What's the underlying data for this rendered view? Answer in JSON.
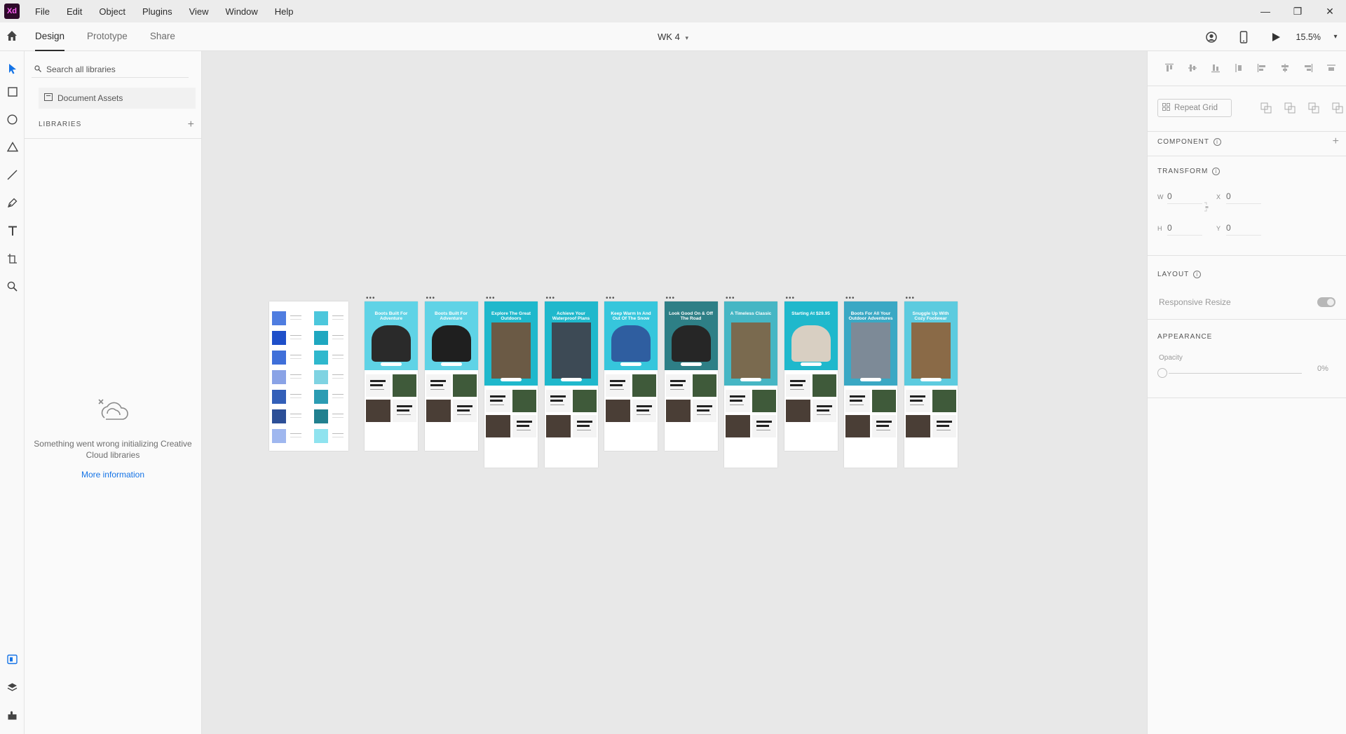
{
  "app": {
    "logo_text": "Xd"
  },
  "menu": [
    "File",
    "Edit",
    "Object",
    "Plugins",
    "View",
    "Window",
    "Help"
  ],
  "window_controls": {
    "minimize": "—",
    "restore": "❐",
    "close": "✕"
  },
  "tabs": [
    "Design",
    "Prototype",
    "Share"
  ],
  "active_tab": "Design",
  "document": {
    "title": "WK 4",
    "zoom": "15.5%"
  },
  "libraries": {
    "search_placeholder": "Search all libraries",
    "document_assets": "Document Assets",
    "header": "LIBRARIES",
    "error_message": "Something went wrong initializing Creative Cloud libraries",
    "more_info": "More information"
  },
  "properties": {
    "repeat_grid": "Repeat Grid",
    "component": "COMPONENT",
    "transform": "TRANSFORM",
    "w_label": "W",
    "w_value": "0",
    "x_label": "X",
    "x_value": "0",
    "h_label": "H",
    "h_value": "0",
    "y_label": "Y",
    "y_value": "0",
    "layout": "LAYOUT",
    "responsive_resize": "Responsive Resize",
    "appearance": "APPEARANCE",
    "opacity_label": "Opacity",
    "opacity_value": "0%"
  },
  "artboards": [
    {
      "title": "Boots Built For Adventure",
      "hero_color": "#5fd3e6",
      "img_color": "#2a2a2a",
      "tall": false
    },
    {
      "title": "Boots Built For Adventure",
      "hero_color": "#5fd3e6",
      "img_color": "#1f1f1f",
      "tall": false
    },
    {
      "title": "Explore The Great Outdoors",
      "hero_color": "#1fb8cc",
      "img_color": "#6b5a45",
      "tall": true
    },
    {
      "title": "Achieve Your Waterproof Plans",
      "hero_color": "#1fb8cc",
      "img_color": "#3d4a55",
      "tall": true
    },
    {
      "title": "Keep Warm In And Out Of The Snow",
      "hero_color": "#36c6dc",
      "img_color": "#2f5ea0",
      "tall": false
    },
    {
      "title": "Look Good On & Off The Road",
      "hero_color": "#2e7f86",
      "img_color": "#262626",
      "tall": false
    },
    {
      "title": "A Timeless Classic",
      "hero_color": "#46b6c4",
      "img_color": "#7a6a4f",
      "tall": true
    },
    {
      "title": "Starting At $29.95",
      "hero_color": "#1fb8cc",
      "img_color": "#d8cfc2",
      "tall": false
    },
    {
      "title": "Boots For All Your Outdoor Adventures",
      "hero_color": "#3aa8c4",
      "img_color": "#7d8a97",
      "tall": true
    },
    {
      "title": "Snuggle Up With Cozy Footwear",
      "hero_color": "#5ccbdf",
      "img_color": "#8a6a47",
      "tall": true
    }
  ],
  "palette": {
    "left": [
      "#4f7de0",
      "#1e4fc9",
      "#3f6fd9",
      "#8aa3e6",
      "#335fb8",
      "#2c4f97",
      "#9fb7ef"
    ],
    "right": [
      "#4cc7dc",
      "#1fa7c0",
      "#2fb8cd",
      "#7fd3e2",
      "#2b9cb3",
      "#21808f",
      "#8fe3ef"
    ]
  }
}
